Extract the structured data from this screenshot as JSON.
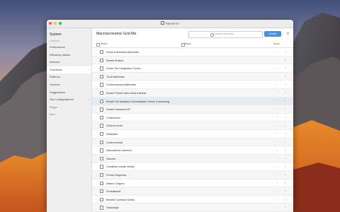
{
  "window": {
    "title": "Reeder for"
  },
  "colors": {
    "accent": "#4a90e2",
    "close": "#fc5f57",
    "minimize": "#fdbd2e",
    "zoom": "#28c840"
  },
  "sidebar": {
    "header": "System",
    "subheader": "Contents",
    "items": [
      {
        "label": "Preferences",
        "chev": ""
      },
      {
        "label": "Efficiency status",
        "chev": ""
      },
      {
        "label": "Devices",
        "chev": ""
      },
      {
        "label": "Overflows",
        "chev": "›"
      },
      {
        "label": "Patterns",
        "chev": ""
      },
      {
        "label": "Screens",
        "chev": ""
      },
      {
        "label": "Suggestions",
        "chev": ""
      },
      {
        "label": "Sav Configurations",
        "chev": "›"
      },
      {
        "label": "Bigger",
        "chev": ""
      },
      {
        "label": "Bias",
        "chev": ""
      }
    ]
  },
  "main": {
    "title": "Macroeconomic Grid Me",
    "search_placeholder": "Search automate",
    "button": "Create",
    "gear_icon": "gear-icon",
    "columns": {
      "col1": "Status",
      "col2": "Status",
      "col3": "Show"
    },
    "rows": [
      "Some Interested Attributes",
      "Desert Rollies",
      "Some Cfe Integration Tunes",
      "Trust Attributes",
      "Contemporary Attributes",
      "Desert Forest Intro band Interest",
      "Desert Clil Installed Columbiastic Grobe Convincing",
      "Desert Immanent R",
      "Contraction",
      "Outdoor Auto",
      "Saltwater",
      "Controversial",
      "Discussions notched",
      "Sarcher",
      "Condition Inside circles",
      "Forme Dispense",
      "Nature Grapes",
      "Sensational",
      "Benefit Combine Notes",
      "Saturdays",
      "Banco Kennedy"
    ],
    "row_icon_a": "›",
    "row_icon_b": "×"
  }
}
